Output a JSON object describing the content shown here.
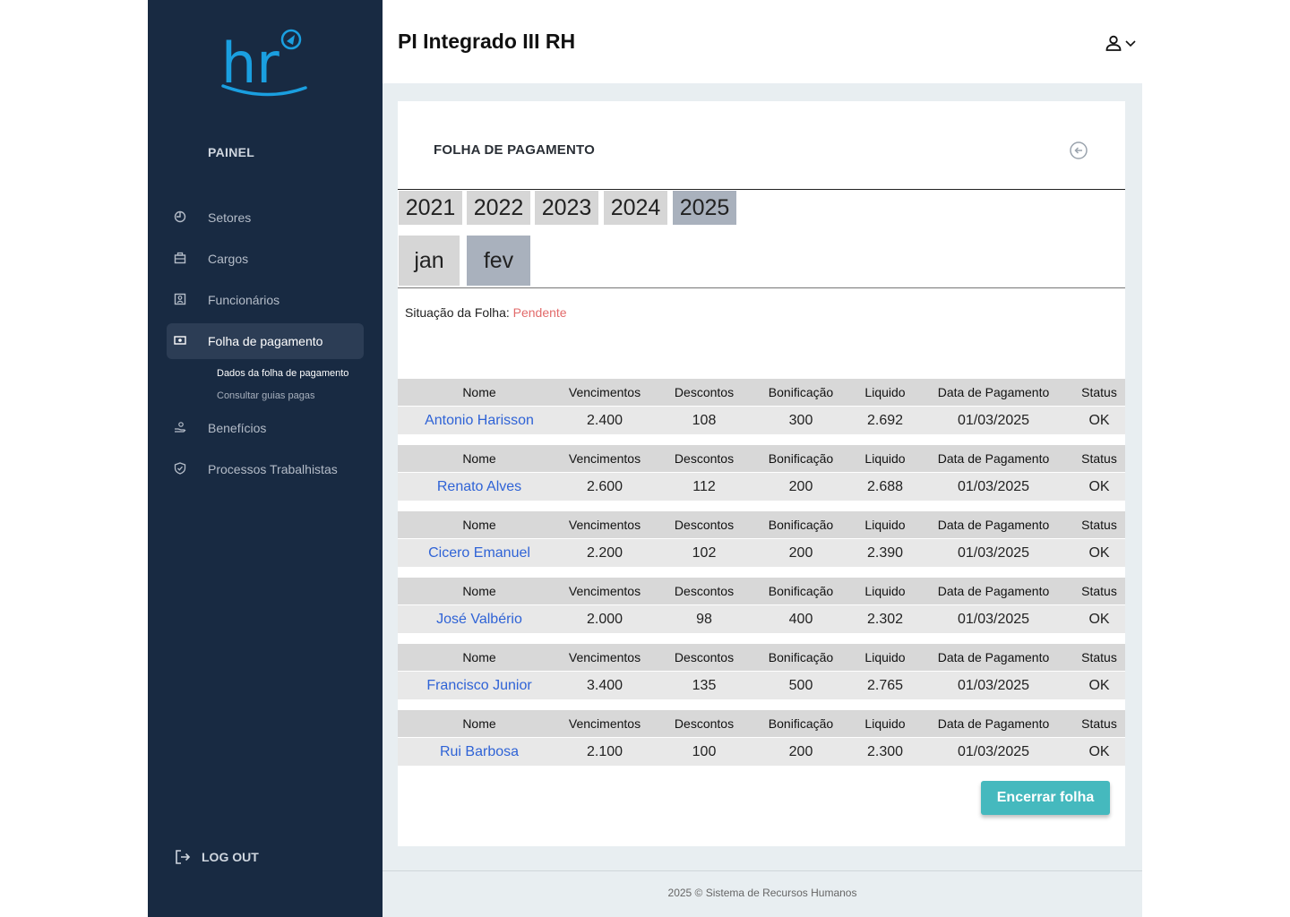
{
  "sidebar": {
    "logo_text": "hr",
    "section_label": "PAINEL",
    "items": [
      {
        "label": "Setores"
      },
      {
        "label": "Cargos"
      },
      {
        "label": "Funcionários"
      },
      {
        "label": "Folha de pagamento",
        "active": true
      },
      {
        "label": "Benefícios"
      },
      {
        "label": "Processos Trabalhistas"
      }
    ],
    "subitems": [
      {
        "label": "Dados da folha de pagamento",
        "current": true
      },
      {
        "label": "Consultar guias pagas"
      }
    ],
    "logout_label": "LOG OUT"
  },
  "header": {
    "title": "PI Integrado III RH"
  },
  "card": {
    "title": "FOLHA DE PAGAMENTO",
    "years": [
      "2021",
      "2022",
      "2023",
      "2024",
      "2025"
    ],
    "selected_year": "2025",
    "months": [
      "jan",
      "fev"
    ],
    "selected_month": "fev",
    "status_label": "Situação da Folha:",
    "status_value": "Pendente",
    "columns": [
      "Nome",
      "Vencimentos",
      "Descontos",
      "Bonificação",
      "Liquido",
      "Data de Pagamento",
      "Status"
    ],
    "employees": [
      {
        "nome": "Antonio Harisson",
        "vencimentos": "2.400",
        "descontos": "108",
        "bonificacao": "300",
        "liquido": "2.692",
        "data": "01/03/2025",
        "status": "OK"
      },
      {
        "nome": "Renato Alves",
        "vencimentos": "2.600",
        "descontos": "112",
        "bonificacao": "200",
        "liquido": "2.688",
        "data": "01/03/2025",
        "status": "OK"
      },
      {
        "nome": "Cicero Emanuel",
        "vencimentos": "2.200",
        "descontos": "102",
        "bonificacao": "200",
        "liquido": "2.390",
        "data": "01/03/2025",
        "status": "OK"
      },
      {
        "nome": "José Valbério",
        "vencimentos": "2.000",
        "descontos": "98",
        "bonificacao": "400",
        "liquido": "2.302",
        "data": "01/03/2025",
        "status": "OK"
      },
      {
        "nome": "Francisco Junior",
        "vencimentos": "3.400",
        "descontos": "135",
        "bonificacao": "500",
        "liquido": "2.765",
        "data": "01/03/2025",
        "status": "OK"
      },
      {
        "nome": "Rui Barbosa",
        "vencimentos": "2.100",
        "descontos": "100",
        "bonificacao": "200",
        "liquido": "2.300",
        "data": "01/03/2025",
        "status": "OK"
      }
    ],
    "close_button_label": "Encerrar folha"
  },
  "footer": {
    "text": "2025 © Sistema de Recursos Humanos"
  },
  "colors": {
    "sidebar_bg": "#182a42",
    "accent": "#45b9be",
    "link": "#2f63d6",
    "status_pending": "#e26a6a",
    "logo_blue": "#1a9fe0"
  }
}
